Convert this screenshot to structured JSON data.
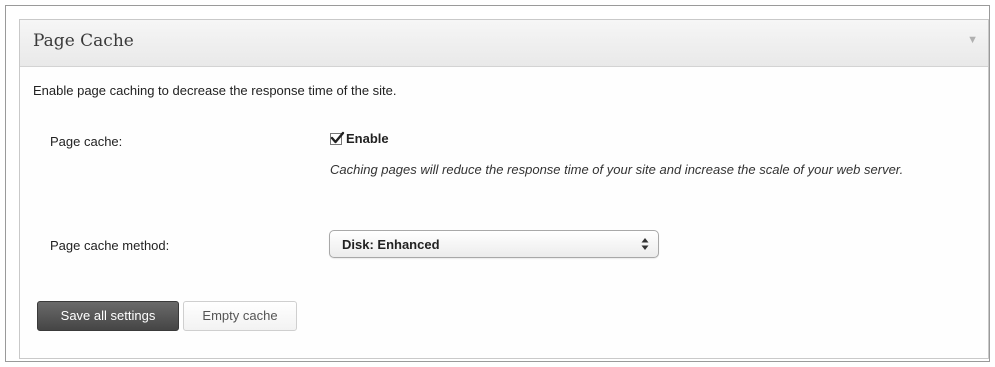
{
  "panel": {
    "title": "Page Cache",
    "toggle_icon": "triangle-down-icon"
  },
  "intro_text": "Enable page caching to decrease the response time of the site.",
  "page_cache": {
    "label": "Page cache:",
    "checkbox_checked": true,
    "checkbox_label": "Enable",
    "description": "Caching pages will reduce the response time of your site and increase the scale of your web server."
  },
  "page_cache_method": {
    "label": "Page cache method:",
    "selected_value": "Disk: Enhanced"
  },
  "buttons": {
    "save_label": "Save all settings",
    "empty_label": "Empty cache"
  },
  "colors": {
    "primary_button": "#555555",
    "border": "#c9c9c9"
  }
}
